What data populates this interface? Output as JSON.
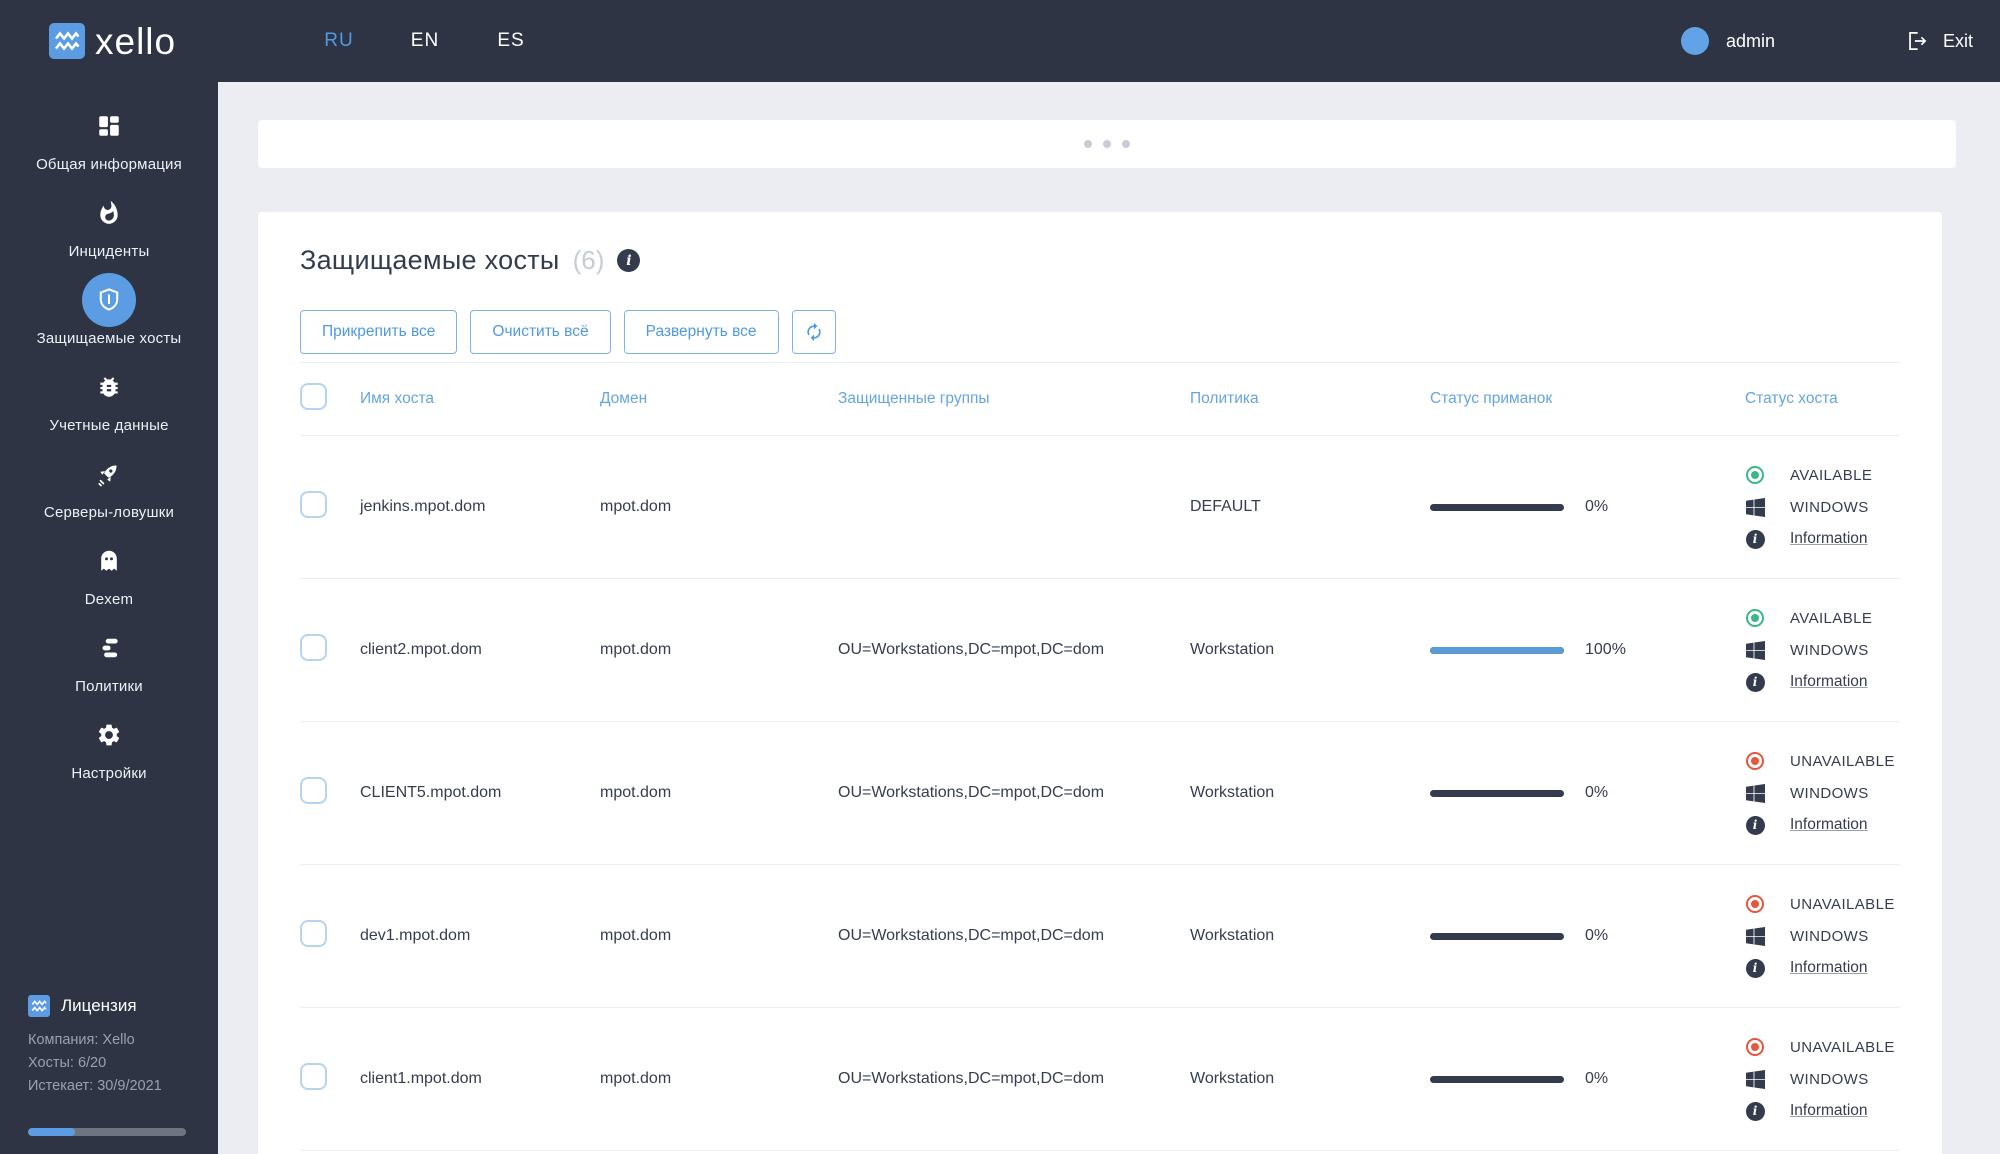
{
  "colors": {
    "topbar_bg": "#2e3443",
    "accent_blue": "#5b9ce2",
    "progress_blue": "#5b9bd8",
    "available_green": "#3cb787",
    "unavailable_red": "#e3573e",
    "bar_track_dark": "#343b4d"
  },
  "topbar": {
    "brand": "xello",
    "languages": [
      {
        "label": "RU",
        "active": true
      },
      {
        "label": "EN",
        "active": false
      },
      {
        "label": "ES",
        "active": false
      }
    ],
    "username": "admin",
    "exit_label": "Exit"
  },
  "sidebar": {
    "items": [
      {
        "label": "Общая информация",
        "icon": "dashboard-icon",
        "active": false
      },
      {
        "label": "Инциденты",
        "icon": "flame-icon",
        "active": false
      },
      {
        "label": "Защищаемые хосты",
        "icon": "shield-icon",
        "active": true
      },
      {
        "label": "Учетные данные",
        "icon": "bug-icon",
        "active": false
      },
      {
        "label": "Серверы-ловушки",
        "icon": "rocket-icon",
        "active": false
      },
      {
        "label": "Dexem",
        "icon": "ghost-icon",
        "active": false
      },
      {
        "label": "Политики",
        "icon": "policy-bars-icon",
        "active": false
      },
      {
        "label": "Настройки",
        "icon": "gear-icon",
        "active": false
      }
    ]
  },
  "license": {
    "title": "Лицензия",
    "company": "Компания: Xello",
    "hosts": "Хосты: 6/20",
    "expires": "Истекает: 30/9/2021",
    "progress_pct": "30%"
  },
  "main": {
    "title": "Защищаемые хосты",
    "count": "(6)",
    "actions": {
      "pin_all": "Прикрепить все",
      "clear_all": "Очистить всё",
      "expand_all": "Развернуть все"
    },
    "table": {
      "headers": {
        "host": "Имя хоста",
        "domain": "Домен",
        "groups": "Защищенные группы",
        "policy": "Политика",
        "decoys": "Статус приманок",
        "status": "Статус хоста"
      },
      "rows": [
        {
          "host": "jenkins.mpot.dom",
          "domain": "mpot.dom",
          "groups": "",
          "policy": "DEFAULT",
          "decoy_pct": "0%",
          "decoy_fill": "0%",
          "status": "AVAILABLE",
          "status_color": "#3cb787",
          "os": "WINDOWS",
          "info": "Information"
        },
        {
          "host": "client2.mpot.dom",
          "domain": "mpot.dom",
          "groups": "OU=Workstations,DC=mpot,DC=dom",
          "policy": "Workstation",
          "decoy_pct": "100%",
          "decoy_fill": "100%",
          "status": "AVAILABLE",
          "status_color": "#3cb787",
          "os": "WINDOWS",
          "info": "Information"
        },
        {
          "host": "CLIENT5.mpot.dom",
          "domain": "mpot.dom",
          "groups": "OU=Workstations,DC=mpot,DC=dom",
          "policy": "Workstation",
          "decoy_pct": "0%",
          "decoy_fill": "0%",
          "status": "UNAVAILABLE",
          "status_color": "#e3573e",
          "os": "WINDOWS",
          "info": "Information"
        },
        {
          "host": "dev1.mpot.dom",
          "domain": "mpot.dom",
          "groups": "OU=Workstations,DC=mpot,DC=dom",
          "policy": "Workstation",
          "decoy_pct": "0%",
          "decoy_fill": "0%",
          "status": "UNAVAILABLE",
          "status_color": "#e3573e",
          "os": "WINDOWS",
          "info": "Information"
        },
        {
          "host": "client1.mpot.dom",
          "domain": "mpot.dom",
          "groups": "OU=Workstations,DC=mpot,DC=dom",
          "policy": "Workstation",
          "decoy_pct": "0%",
          "decoy_fill": "0%",
          "status": "UNAVAILABLE",
          "status_color": "#e3573e",
          "os": "WINDOWS",
          "info": "Information"
        }
      ]
    }
  }
}
